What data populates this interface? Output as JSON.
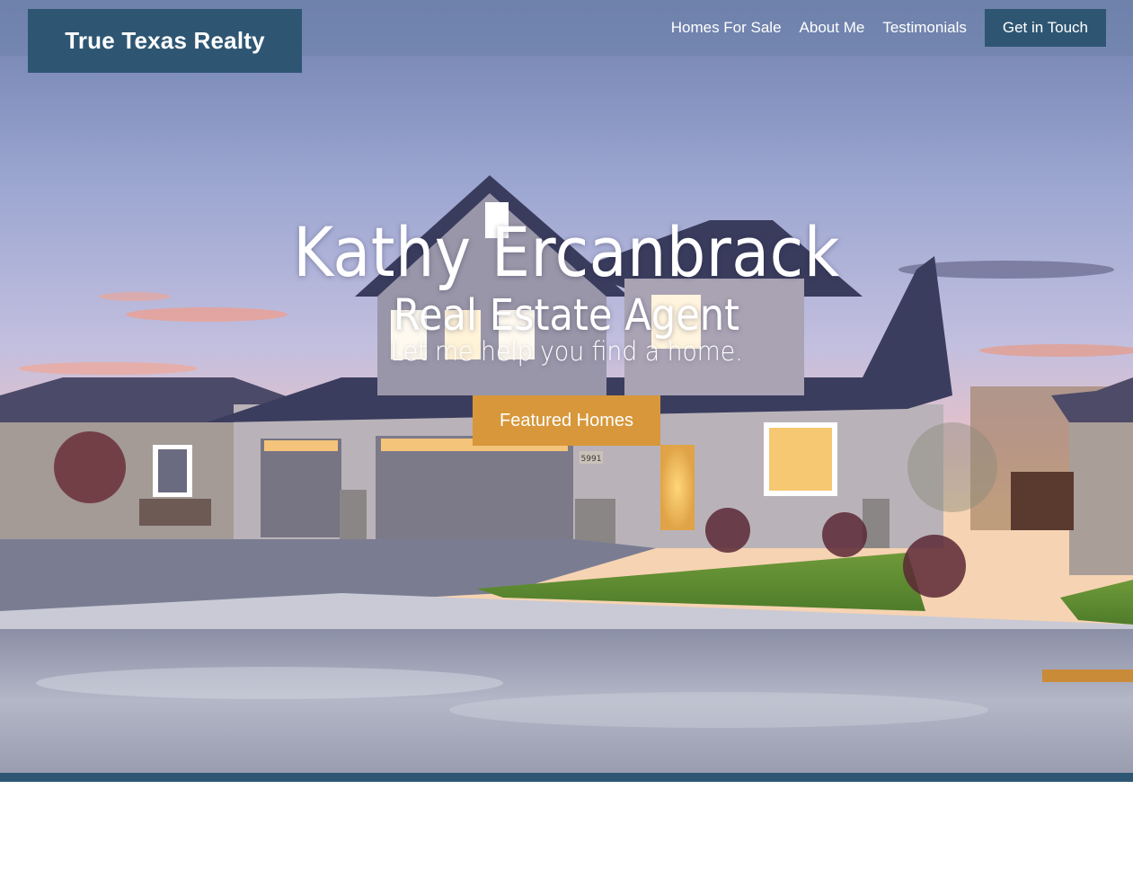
{
  "brand": {
    "name": "True Texas Realty"
  },
  "nav": {
    "items": [
      {
        "label": "Homes For Sale"
      },
      {
        "label": "About Me"
      },
      {
        "label": "Testimonials"
      }
    ],
    "cta_label": "Get in Touch"
  },
  "hero": {
    "name": "Kathy Ercanbrack",
    "role": "Real Estate Agent",
    "tagline": "Let me help you find a home.",
    "button_label": "Featured Homes",
    "house_number": "5991"
  },
  "colors": {
    "brand_navy": "#2e5673",
    "accent_gold": "#d7973a",
    "sky_lavender": "#9aa6cf"
  }
}
